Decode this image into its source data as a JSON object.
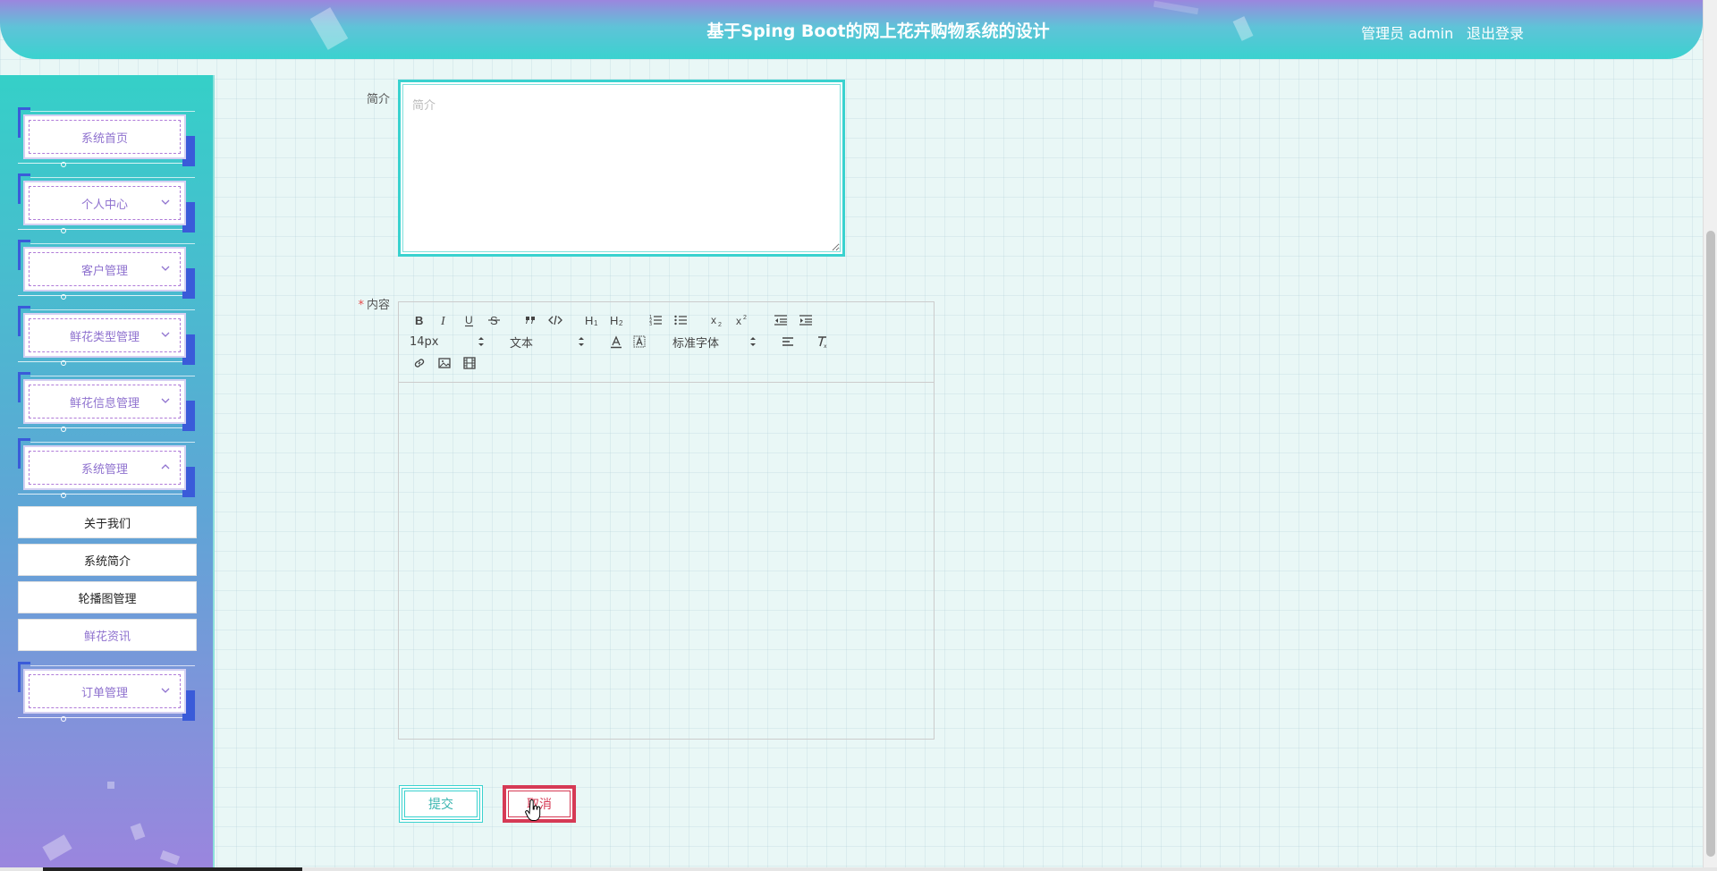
{
  "header": {
    "title": "基于Sping Boot的网上花卉购物系统的设计",
    "user_label": "管理员 admin",
    "logout_label": "退出登录"
  },
  "sidebar": {
    "menus": [
      {
        "label": "系统首页",
        "has_arrow": false
      },
      {
        "label": "个人中心",
        "has_arrow": true,
        "arrow": "down"
      },
      {
        "label": "客户管理",
        "has_arrow": true,
        "arrow": "down"
      },
      {
        "label": "鲜花类型管理",
        "has_arrow": true,
        "arrow": "down"
      },
      {
        "label": "鲜花信息管理",
        "has_arrow": true,
        "arrow": "down"
      },
      {
        "label": "系统管理",
        "has_arrow": true,
        "arrow": "up"
      },
      {
        "label": "订单管理",
        "has_arrow": true,
        "arrow": "down"
      }
    ],
    "submenu": [
      {
        "label": "关于我们"
      },
      {
        "label": "系统简介"
      },
      {
        "label": "轮播图管理"
      },
      {
        "label": "鲜花资讯",
        "active": true
      }
    ]
  },
  "form": {
    "intro_label": "简介",
    "intro_placeholder": "简介",
    "intro_value": "",
    "content_label": "内容",
    "content_required_mark": "*",
    "editor": {
      "font_size": "14px",
      "header_select": "文本",
      "font_family": "标准字体",
      "h1": "H1",
      "h2": "H2",
      "sub": "x₂",
      "sup": "x²"
    },
    "submit_label": "提交",
    "cancel_label": "取消"
  },
  "colors": {
    "accent": "#3ad2cf",
    "purple": "#8f72cf",
    "danger": "#d63a55"
  }
}
